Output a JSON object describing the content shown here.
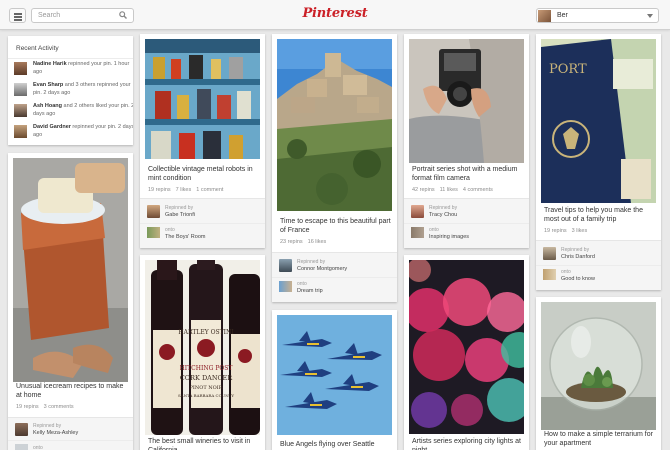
{
  "header": {
    "search_placeholder": "Search",
    "logo": "Pinterest",
    "user_name": "Ber"
  },
  "recent_activity": {
    "title": "Recent Activity",
    "items": [
      {
        "name": "Nadine Harik",
        "text": " repinned your pin.",
        "time": "1 hour ago"
      },
      {
        "name": "Evan Sharp",
        "text": " and 3 others repinned your pin.",
        "time": "2 days ago"
      },
      {
        "name": "Ash Hoang",
        "text": " and 2 others liked your pin.",
        "time": "2 days ago"
      },
      {
        "name": "David Gardner",
        "text": " repinned your pin.",
        "time": "2 days ago"
      }
    ]
  },
  "pins": {
    "icecream": {
      "desc": "Unusual icecream recipes to make at home",
      "repins": "19 repins",
      "comments": "3 comments",
      "via_label": "Repinned by",
      "via_name": "Kelly Meza-Ashley",
      "board_user": "onto"
    },
    "robots": {
      "desc": "Collectible vintage metal robots in mint condition",
      "repins": "19 repins",
      "likes": "7 likes",
      "comments": "1 comment",
      "via_label": "Repinned by",
      "via_name": "Gabe Trionfi",
      "board_user": "onto",
      "board": "The Boys' Room"
    },
    "wine": {
      "desc": "The best small wineries to visit in California"
    },
    "france": {
      "desc": "Time to escape to this beautiful part of France",
      "repins": "23 repins",
      "likes": "16 likes",
      "via_label": "Repinned by",
      "via_name": "Connor Montgomery",
      "board_user": "onto",
      "board": "Dream trip"
    },
    "jets": {
      "desc": "Blue Angels flying over Seattle"
    },
    "camera": {
      "desc": "Portrait series shot with a medium format film camera",
      "repins": "42 repins",
      "likes": "11 likes",
      "comments": "4 comments",
      "via_label": "Repinned by",
      "via_name": "Tracy Chou",
      "board_user": "onto",
      "board": "Inspiring images"
    },
    "bokeh": {
      "desc": "Artists series exploring city lights at night"
    },
    "passport": {
      "desc": "Travel tips to help you make the most out of a family trip",
      "repins": "19 repins",
      "likes": "3 likes",
      "via_label": "Repinned by",
      "via_name": "Chris Danford",
      "board_user": "onto",
      "board": "Good to know"
    },
    "terrarium": {
      "desc": "How to make a simple terrarium for your apartment"
    }
  },
  "label_art": {
    "line1": "HARTLEY OSTINI",
    "line2": "HITCHING POST",
    "line3": "CORK DANCER",
    "line4": "PINOT NOIR",
    "line5": "SANTA BARBARA COUNTY"
  }
}
